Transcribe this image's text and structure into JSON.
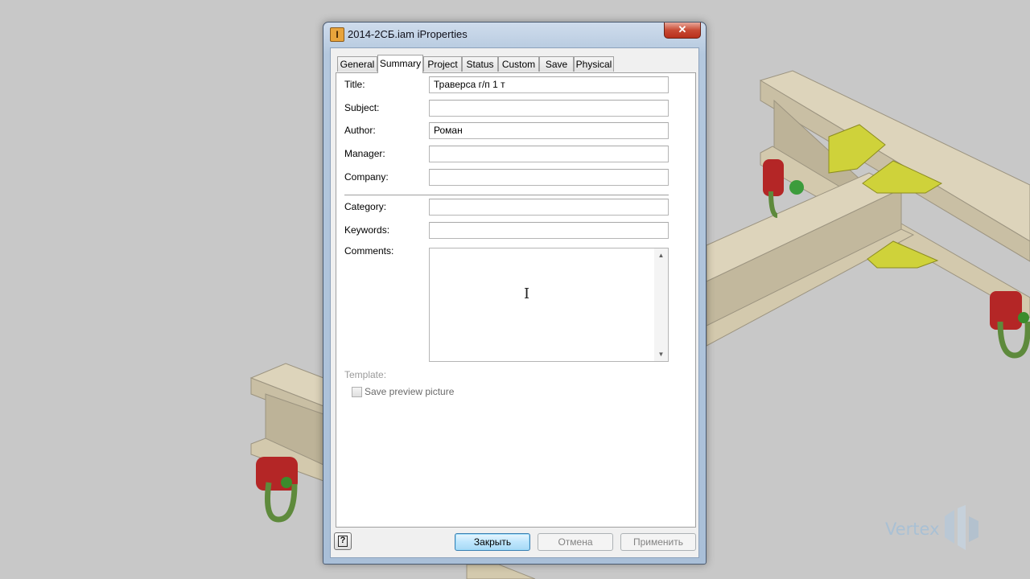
{
  "window": {
    "title": "2014-2СБ.iam iProperties",
    "app_icon": "I",
    "close_symbol": "✕"
  },
  "tabs": [
    {
      "label": "General"
    },
    {
      "label": "Summary"
    },
    {
      "label": "Project"
    },
    {
      "label": "Status"
    },
    {
      "label": "Custom"
    },
    {
      "label": "Save"
    },
    {
      "label": "Physical"
    }
  ],
  "active_tab": "Summary",
  "summary": {
    "title_label": "Title:",
    "title_value": "Траверса г/п 1 т",
    "subject_label": "Subject:",
    "subject_value": "",
    "author_label": "Author:",
    "author_value": "Роман",
    "manager_label": "Manager:",
    "manager_value": "",
    "company_label": "Company:",
    "company_value": "",
    "category_label": "Category:",
    "category_value": "",
    "keywords_label": "Keywords:",
    "keywords_value": "",
    "comments_label": "Comments:",
    "comments_value": "",
    "template_label": "Template:",
    "save_preview_label": "Save preview picture",
    "save_preview_checked": false
  },
  "footer": {
    "help_symbol": "?",
    "close_label": "Закрыть",
    "cancel_label": "Отмена",
    "apply_label": "Применить"
  },
  "watermark": {
    "text": "Vertex"
  },
  "icons": [
    "app-icon",
    "close-icon",
    "help-icon",
    "scroll-up-icon",
    "scroll-down-icon",
    "text-cursor-icon"
  ],
  "colors": {
    "background": "#c8c8c8",
    "beam": "#d3c9ad",
    "gusset": "#cfd23a",
    "hook_body": "#b42626",
    "hook_ring": "#5e8a3c"
  }
}
